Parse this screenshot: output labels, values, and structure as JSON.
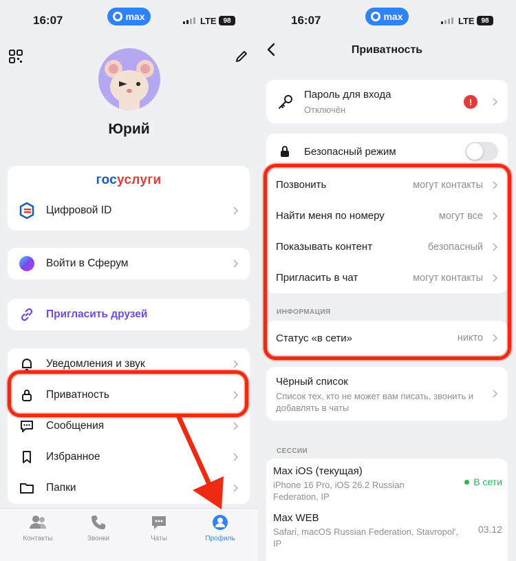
{
  "status_left": {
    "time": "16:07",
    "app_pill": "max",
    "network": "LTE",
    "battery": "98"
  },
  "status_right": {
    "time": "16:07",
    "app_pill": "max",
    "network": "LTE",
    "battery": "98"
  },
  "profile": {
    "name": "Юрий",
    "gosuslugi": {
      "part1": "гос",
      "part2": "услуги"
    },
    "items": [
      {
        "label": "Цифровой ID"
      },
      {
        "label": "Войти в Сферум"
      },
      {
        "label": "Пригласить друзей"
      },
      {
        "label": "Уведомления и звук"
      },
      {
        "label": "Приватность"
      },
      {
        "label": "Сообщения"
      },
      {
        "label": "Избранное"
      },
      {
        "label": "Папки"
      }
    ]
  },
  "tabs": [
    {
      "label": "Контакты"
    },
    {
      "label": "Звонки"
    },
    {
      "label": "Чаты"
    },
    {
      "label": "Профиль"
    }
  ],
  "privacy": {
    "title": "Приватность",
    "password": {
      "label": "Пароль для входа",
      "value": "Отключён",
      "alert": "!"
    },
    "safe_mode": {
      "label": "Безопасный режим",
      "enabled": false
    },
    "rows": [
      {
        "label": "Позвонить",
        "value": "могут контакты"
      },
      {
        "label": "Найти меня по номеру",
        "value": "могут все"
      },
      {
        "label": "Показывать контент",
        "value": "безопасный"
      },
      {
        "label": "Пригласить в чат",
        "value": "могут контакты"
      }
    ],
    "info_header": "ИНФОРМАЦИЯ",
    "online_status": {
      "label": "Статус «в сети»",
      "value": "никто"
    },
    "blacklist": {
      "label": "Чёрный список",
      "desc": "Список тех, кто не может вам писать, звонить и добавлять в чаты"
    },
    "sessions_header": "СЕССИИ",
    "sessions": [
      {
        "name": "Max iOS (текущая)",
        "desc": "iPhone 16 Pro, iOS 26.2 Russian Federation, IP",
        "status": "В сети"
      },
      {
        "name": "Max WEB",
        "desc": "Safari, macOS Russian Federation, Stavropol', IP",
        "date": "03.12"
      }
    ]
  },
  "colors": {
    "accent": "#2f83f6",
    "annotation": "#ee2a12",
    "invite": "#6f4ad9",
    "online": "#27b85a"
  }
}
